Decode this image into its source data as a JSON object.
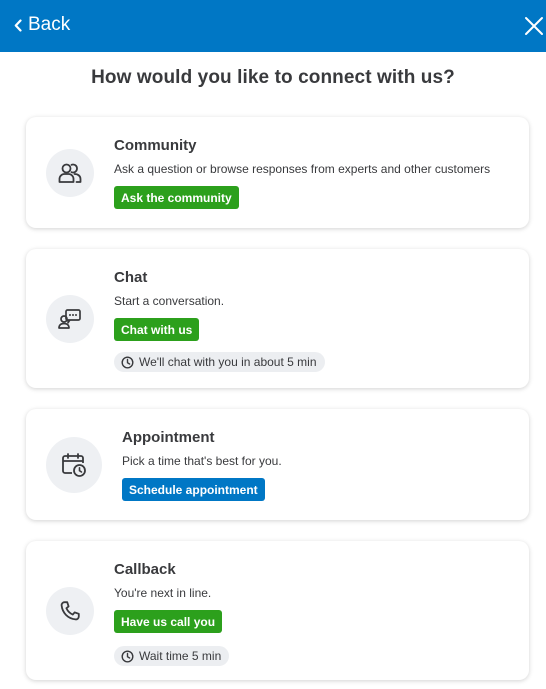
{
  "header": {
    "back_label": "Back",
    "background_color": "#0077c5",
    "close_icon": "close-icon",
    "back_icon": "chevron-left-icon"
  },
  "heading": "How would you like to connect with us?",
  "options": {
    "community": {
      "icon": "people-icon",
      "title": "Community",
      "description": "Ask a question or browse responses from experts and other customers",
      "button_label": "Ask the community"
    },
    "chat": {
      "icon": "chat-icon",
      "title": "Chat",
      "description": "Start a conversation.",
      "button_label": "Chat with us",
      "status": "We'll chat with you in about 5 min"
    },
    "appointment": {
      "icon": "calendar-clock-icon",
      "title": "Appointment",
      "description": "Pick a time that's best for you.",
      "button_label": "Schedule appointment"
    },
    "callback": {
      "icon": "phone-icon",
      "title": "Callback",
      "description": "You're next in line.",
      "button_label": "Have us call you",
      "status": "Wait time 5 min"
    }
  },
  "colors": {
    "primary_green": "#2ca01c",
    "primary_blue": "#0077c5",
    "text": "#393a3d",
    "pill_background": "#eceef1"
  }
}
